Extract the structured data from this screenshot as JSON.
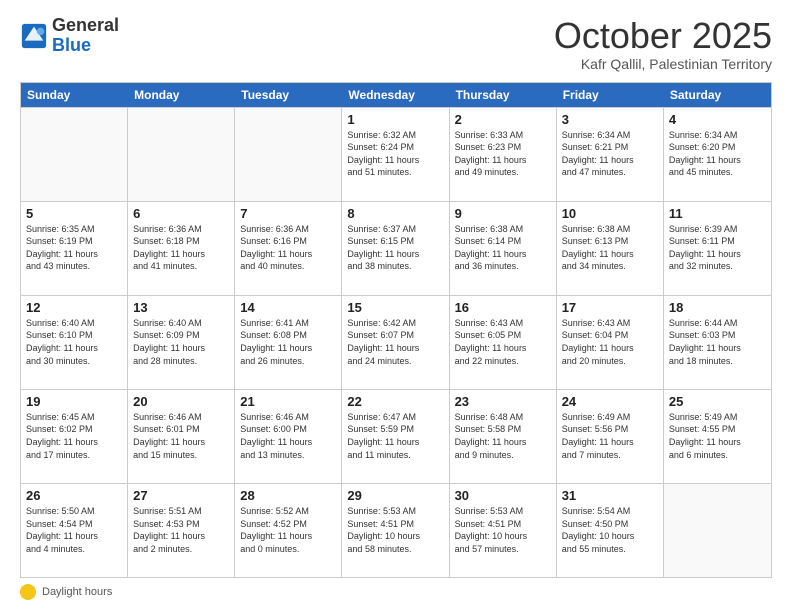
{
  "header": {
    "logo_general": "General",
    "logo_blue": "Blue",
    "month": "October 2025",
    "location": "Kafr Qallil, Palestinian Territory"
  },
  "days_of_week": [
    "Sunday",
    "Monday",
    "Tuesday",
    "Wednesday",
    "Thursday",
    "Friday",
    "Saturday"
  ],
  "weeks": [
    [
      {
        "day": "",
        "info": ""
      },
      {
        "day": "",
        "info": ""
      },
      {
        "day": "",
        "info": ""
      },
      {
        "day": "1",
        "info": "Sunrise: 6:32 AM\nSunset: 6:24 PM\nDaylight: 11 hours\nand 51 minutes."
      },
      {
        "day": "2",
        "info": "Sunrise: 6:33 AM\nSunset: 6:23 PM\nDaylight: 11 hours\nand 49 minutes."
      },
      {
        "day": "3",
        "info": "Sunrise: 6:34 AM\nSunset: 6:21 PM\nDaylight: 11 hours\nand 47 minutes."
      },
      {
        "day": "4",
        "info": "Sunrise: 6:34 AM\nSunset: 6:20 PM\nDaylight: 11 hours\nand 45 minutes."
      }
    ],
    [
      {
        "day": "5",
        "info": "Sunrise: 6:35 AM\nSunset: 6:19 PM\nDaylight: 11 hours\nand 43 minutes."
      },
      {
        "day": "6",
        "info": "Sunrise: 6:36 AM\nSunset: 6:18 PM\nDaylight: 11 hours\nand 41 minutes."
      },
      {
        "day": "7",
        "info": "Sunrise: 6:36 AM\nSunset: 6:16 PM\nDaylight: 11 hours\nand 40 minutes."
      },
      {
        "day": "8",
        "info": "Sunrise: 6:37 AM\nSunset: 6:15 PM\nDaylight: 11 hours\nand 38 minutes."
      },
      {
        "day": "9",
        "info": "Sunrise: 6:38 AM\nSunset: 6:14 PM\nDaylight: 11 hours\nand 36 minutes."
      },
      {
        "day": "10",
        "info": "Sunrise: 6:38 AM\nSunset: 6:13 PM\nDaylight: 11 hours\nand 34 minutes."
      },
      {
        "day": "11",
        "info": "Sunrise: 6:39 AM\nSunset: 6:11 PM\nDaylight: 11 hours\nand 32 minutes."
      }
    ],
    [
      {
        "day": "12",
        "info": "Sunrise: 6:40 AM\nSunset: 6:10 PM\nDaylight: 11 hours\nand 30 minutes."
      },
      {
        "day": "13",
        "info": "Sunrise: 6:40 AM\nSunset: 6:09 PM\nDaylight: 11 hours\nand 28 minutes."
      },
      {
        "day": "14",
        "info": "Sunrise: 6:41 AM\nSunset: 6:08 PM\nDaylight: 11 hours\nand 26 minutes."
      },
      {
        "day": "15",
        "info": "Sunrise: 6:42 AM\nSunset: 6:07 PM\nDaylight: 11 hours\nand 24 minutes."
      },
      {
        "day": "16",
        "info": "Sunrise: 6:43 AM\nSunset: 6:05 PM\nDaylight: 11 hours\nand 22 minutes."
      },
      {
        "day": "17",
        "info": "Sunrise: 6:43 AM\nSunset: 6:04 PM\nDaylight: 11 hours\nand 20 minutes."
      },
      {
        "day": "18",
        "info": "Sunrise: 6:44 AM\nSunset: 6:03 PM\nDaylight: 11 hours\nand 18 minutes."
      }
    ],
    [
      {
        "day": "19",
        "info": "Sunrise: 6:45 AM\nSunset: 6:02 PM\nDaylight: 11 hours\nand 17 minutes."
      },
      {
        "day": "20",
        "info": "Sunrise: 6:46 AM\nSunset: 6:01 PM\nDaylight: 11 hours\nand 15 minutes."
      },
      {
        "day": "21",
        "info": "Sunrise: 6:46 AM\nSunset: 6:00 PM\nDaylight: 11 hours\nand 13 minutes."
      },
      {
        "day": "22",
        "info": "Sunrise: 6:47 AM\nSunset: 5:59 PM\nDaylight: 11 hours\nand 11 minutes."
      },
      {
        "day": "23",
        "info": "Sunrise: 6:48 AM\nSunset: 5:58 PM\nDaylight: 11 hours\nand 9 minutes."
      },
      {
        "day": "24",
        "info": "Sunrise: 6:49 AM\nSunset: 5:56 PM\nDaylight: 11 hours\nand 7 minutes."
      },
      {
        "day": "25",
        "info": "Sunrise: 5:49 AM\nSunset: 4:55 PM\nDaylight: 11 hours\nand 6 minutes."
      }
    ],
    [
      {
        "day": "26",
        "info": "Sunrise: 5:50 AM\nSunset: 4:54 PM\nDaylight: 11 hours\nand 4 minutes."
      },
      {
        "day": "27",
        "info": "Sunrise: 5:51 AM\nSunset: 4:53 PM\nDaylight: 11 hours\nand 2 minutes."
      },
      {
        "day": "28",
        "info": "Sunrise: 5:52 AM\nSunset: 4:52 PM\nDaylight: 11 hours\nand 0 minutes."
      },
      {
        "day": "29",
        "info": "Sunrise: 5:53 AM\nSunset: 4:51 PM\nDaylight: 10 hours\nand 58 minutes."
      },
      {
        "day": "30",
        "info": "Sunrise: 5:53 AM\nSunset: 4:51 PM\nDaylight: 10 hours\nand 57 minutes."
      },
      {
        "day": "31",
        "info": "Sunrise: 5:54 AM\nSunset: 4:50 PM\nDaylight: 10 hours\nand 55 minutes."
      },
      {
        "day": "",
        "info": ""
      }
    ]
  ],
  "footer": {
    "note": "Daylight hours"
  }
}
